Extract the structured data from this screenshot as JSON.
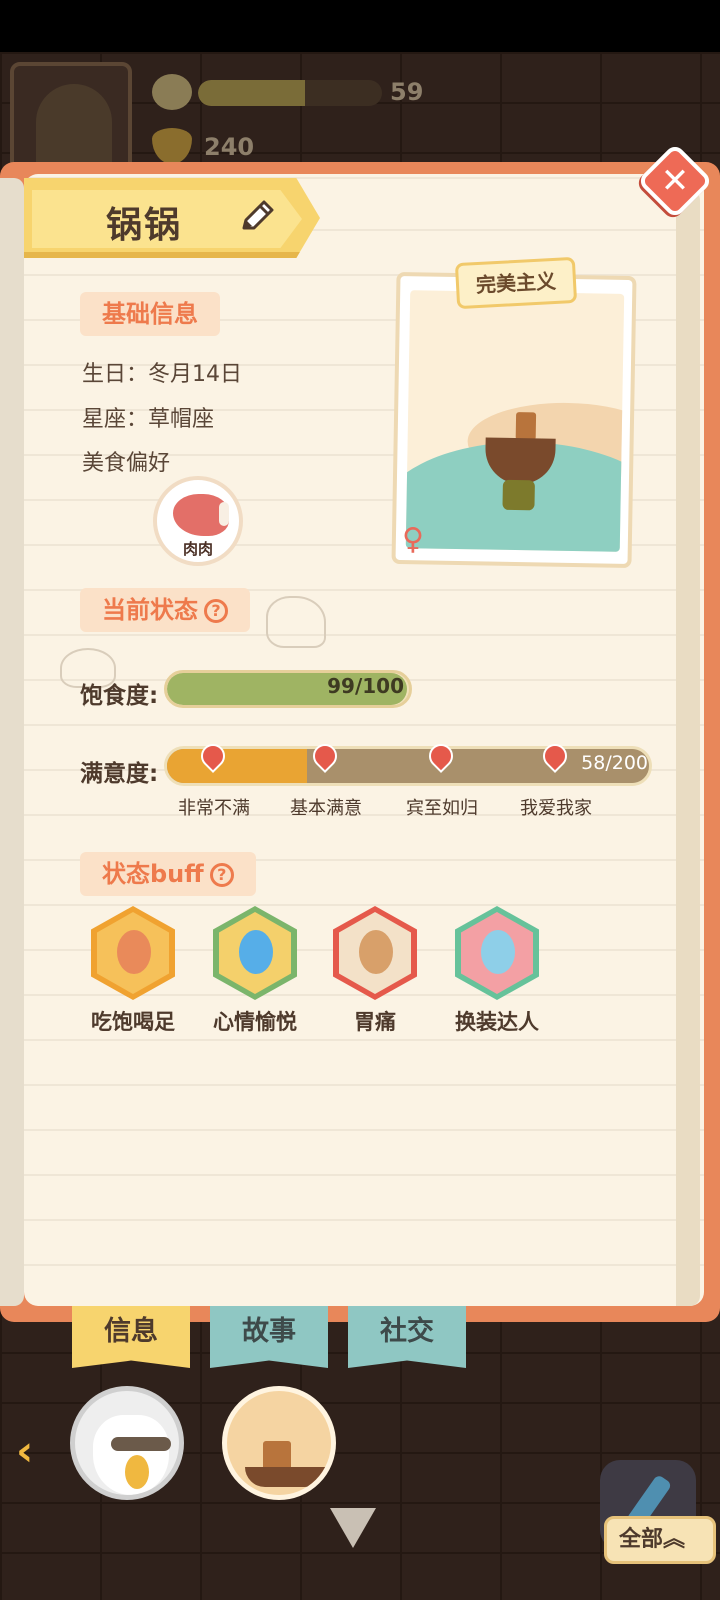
{
  "hud": {
    "flower_icon": "flower-icon",
    "energy_value": "59",
    "energy_percent": 0.58,
    "banana_icon": "banana-icon",
    "banana_value": "240"
  },
  "profile": {
    "name": "锅锅",
    "edit_icon": "pencil-icon",
    "close_icon": "close-icon"
  },
  "basic_info": {
    "heading": "基础信息",
    "birthday": "生日：冬月14日",
    "constellation": "星座：草帽座",
    "food_pref_label": "美食偏好",
    "food_item": "肉肉"
  },
  "photo": {
    "tag": "完美主义",
    "gender_symbol": "♀"
  },
  "status": {
    "heading": "当前状态",
    "help_symbol": "?",
    "satiety_label": "饱食度:",
    "satiety_text": "99/100",
    "satiety_value": 99,
    "satiety_max": 100,
    "happiness_label": "满意度:",
    "happiness_text": "58/200",
    "happiness_value": 58,
    "happiness_max": 200,
    "milestones": [
      "非常不满",
      "基本满意",
      "宾至如归",
      "我爱我家"
    ]
  },
  "buffs": {
    "heading": "状态buff",
    "help_symbol": "?",
    "items": [
      {
        "label": "吃饱喝足",
        "ring": "#f0a230",
        "inner": "#f6c15a",
        "face": "#e98a5a"
      },
      {
        "label": "心情愉悦",
        "ring": "#7bb56b",
        "inner": "#f4d06b",
        "face": "#56aee8"
      },
      {
        "label": "胃痛",
        "ring": "#e5594b",
        "inner": "#f3e1c8",
        "face": "#d8a06a"
      },
      {
        "label": "换装达人",
        "ring": "#66c29a",
        "inner": "#f3a0a4",
        "face": "#8ecfe8"
      }
    ]
  },
  "tabs": [
    "信息",
    "故事",
    "社交"
  ],
  "bottom": {
    "back_symbol": "‹",
    "all_label": "全部︽"
  },
  "colors": {
    "accent_orange": "#ee7a4c",
    "panel_border": "#e8875a",
    "tab_active": "#f7d46e",
    "tab_inactive": "#8fc7c3"
  }
}
